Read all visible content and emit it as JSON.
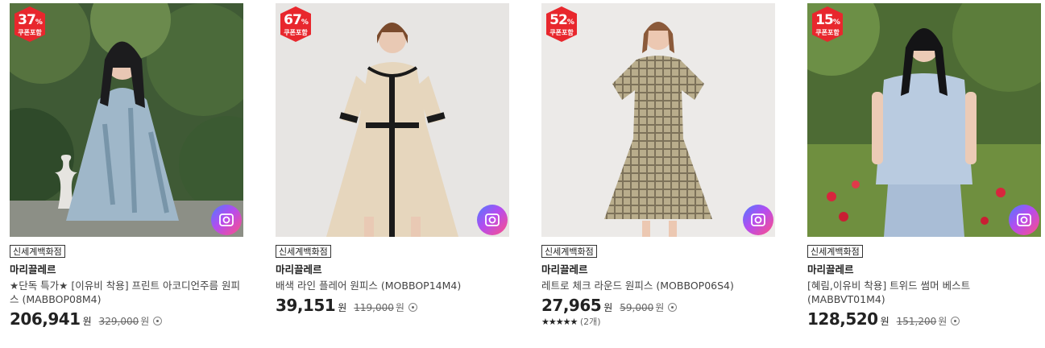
{
  "colors": {
    "badge": "#e8272d",
    "camera_gradient": [
      "#4d7bff",
      "#b44cf0",
      "#ff4f86"
    ]
  },
  "products": [
    {
      "discount_value": "37",
      "discount_unit": "%",
      "discount_label": "쿠폰포함",
      "store_tag": "신세계백화점",
      "brand": "마리끌레르",
      "name": "★단독 특가★ [이유비 착용] 프린트 아코디언주름 원피스 (MABBOP08M4)",
      "sale_price": "206,941",
      "sale_unit": "원",
      "original_price": "329,000",
      "original_unit": "원"
    },
    {
      "discount_value": "67",
      "discount_unit": "%",
      "discount_label": "쿠폰포함",
      "store_tag": "신세계백화점",
      "brand": "마리끌레르",
      "name": "배색 라인 플레어 원피스 (MOBBOP14M4)",
      "sale_price": "39,151",
      "sale_unit": "원",
      "original_price": "119,000",
      "original_unit": "원"
    },
    {
      "discount_value": "52",
      "discount_unit": "%",
      "discount_label": "쿠폰포함",
      "store_tag": "신세계백화점",
      "brand": "마리끌레르",
      "name": "레트로 체크 라운드 원피스 (MOBBOP06S4)",
      "sale_price": "27,965",
      "sale_unit": "원",
      "original_price": "59,000",
      "original_unit": "원",
      "rating_stars": "★★★★★",
      "rating_value": 4.5,
      "review_count": "(2개)"
    },
    {
      "discount_value": "15",
      "discount_unit": "%",
      "discount_label": "쿠폰포함",
      "store_tag": "신세계백화점",
      "brand": "마리끌레르",
      "name": "[혜림,이유비 착용] 트위드 썸머 베스트 (MABBVT01M4)",
      "sale_price": "128,520",
      "sale_unit": "원",
      "original_price": "151,200",
      "original_unit": "원"
    }
  ]
}
